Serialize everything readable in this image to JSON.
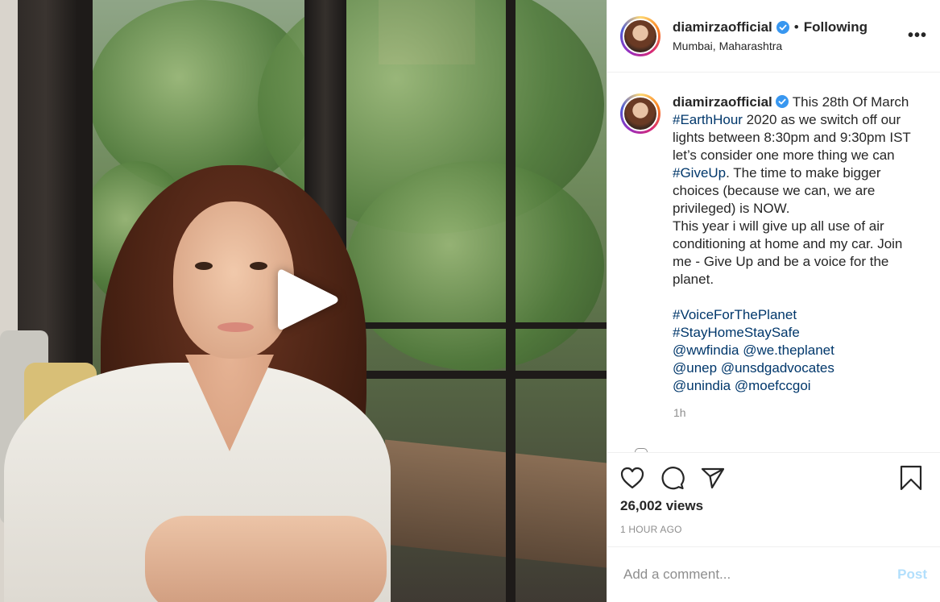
{
  "header": {
    "username": "diamirzaofficial",
    "separator": "•",
    "follow_state": "Following",
    "location": "Mumbai, Maharashtra",
    "more_label": "•••"
  },
  "caption": {
    "username": "diamirzaofficial",
    "segments_line1": [
      {
        "text": "This 28th Of March ",
        "tag": false
      },
      {
        "text": "#EarthHour",
        "tag": true
      },
      {
        "text": " 2020 as we switch off our lights between 8:30pm and 9:30pm IST let’s consider one more thing we can ",
        "tag": false
      },
      {
        "text": "#GiveUp",
        "tag": true
      },
      {
        "text": ". The time to make bigger choices (because we can, we are privileged) is NOW.",
        "tag": false
      }
    ],
    "paragraph2": "This year i will give up all use of air conditioning at home and my car. Join me - Give Up and be a voice for the planet.",
    "tags_block": [
      {
        "text": "#VoiceForThePlanet",
        "tag": true
      },
      {
        "text": " ",
        "tag": false
      },
      {
        "text": "#StayHomeStaySafe",
        "tag": true
      },
      {
        "text": " ",
        "tag": false
      },
      {
        "text": "@wwfindia",
        "tag": true
      },
      {
        "text": " ",
        "tag": false
      },
      {
        "text": "@we.theplanet",
        "tag": true
      },
      {
        "text": " ",
        "tag": false
      },
      {
        "text": "@unep",
        "tag": true
      },
      {
        "text": " ",
        "tag": false
      },
      {
        "text": "@unsdgadvocates",
        "tag": true
      },
      {
        "text": " ",
        "tag": false
      },
      {
        "text": "@unindia",
        "tag": true
      },
      {
        "text": " ",
        "tag": false
      },
      {
        "text": "@moefccgoi",
        "tag": true
      }
    ],
    "time_ago": "1h"
  },
  "stats": {
    "views": "26,002 views",
    "posted": "1 HOUR AGO"
  },
  "comment": {
    "placeholder": "Add a comment...",
    "post_label": "Post"
  },
  "colors": {
    "link": "#00376b",
    "verified": "#3897f0",
    "post_button_disabled": "#b2dffc"
  },
  "icons": [
    "play-icon",
    "verified-badge-icon",
    "more-options-icon",
    "heart-icon",
    "comment-icon",
    "share-icon",
    "bookmark-icon"
  ]
}
